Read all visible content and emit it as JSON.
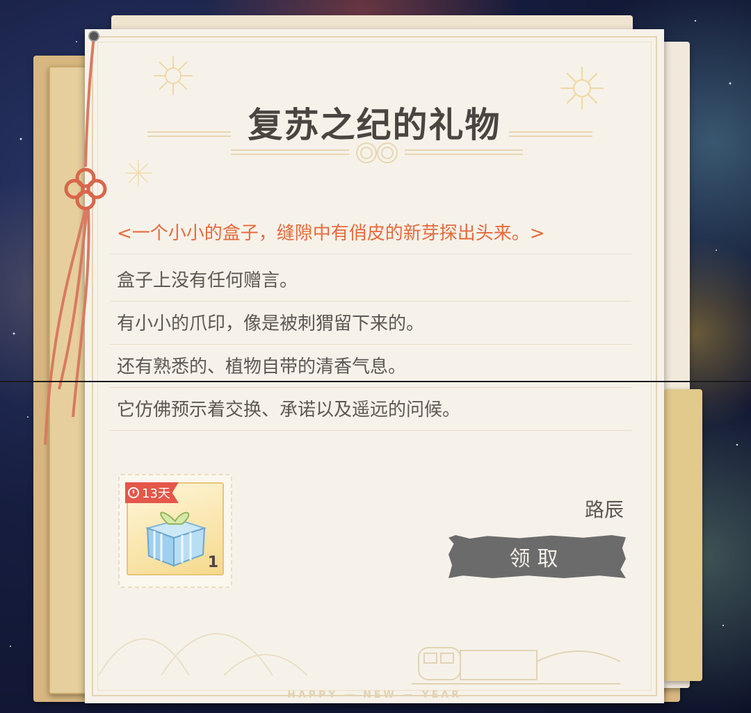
{
  "letter": {
    "title": "复苏之纪的礼物",
    "lines": [
      "<一个小小的盒子，缝隙中有俏皮的新芽探出头来。>",
      "盒子上没有任何赠言。",
      "有小小的爪印，像是被刺猬留下来的。",
      "还有熟悉的、植物自带的清香气息。",
      "它仿佛预示着交换、承诺以及遥远的问候。"
    ],
    "sender": "路辰",
    "claim_button": "领取",
    "footer": "HAPPY — NEW — YEAR"
  },
  "item": {
    "icon": "gift-box-icon",
    "badge": "13天",
    "quantity": "1"
  },
  "colors": {
    "highlight": "#e66a3c",
    "text": "#5c5752",
    "button": "#6b6b6b",
    "badge": "#e4574a"
  }
}
